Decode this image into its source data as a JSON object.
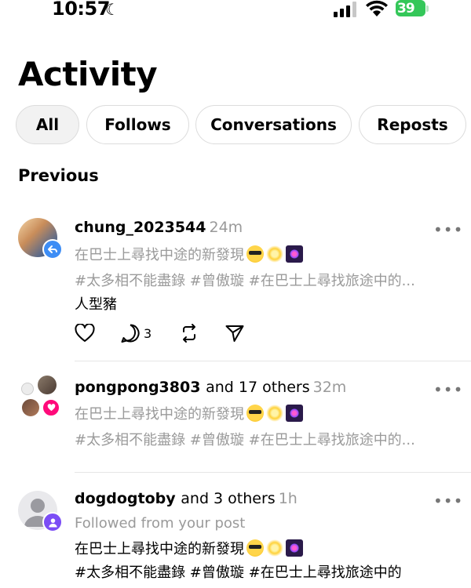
{
  "status": {
    "time": "10:57",
    "battery": "39"
  },
  "title": "Activity",
  "tabs": [
    {
      "label": "All"
    },
    {
      "label": "Follows"
    },
    {
      "label": "Conversations"
    },
    {
      "label": "Reposts"
    }
  ],
  "section": "Previous",
  "items": [
    {
      "username": "chung_2023544",
      "time": "24m",
      "quote": "在巴士上尋找中途的新發現",
      "hashtags": "#太多相不能盡錄 #曾傲璇 #在巴士上尋找旅途中的...",
      "reply": "人型豬",
      "reply_count": "3"
    },
    {
      "username": "pongpong3803",
      "others": "and 17 others",
      "time": "32m",
      "quote": "在巴士上尋找中途的新發現",
      "hashtags": "#太多相不能盡錄 #曾傲璇 #在巴士上尋找旅途中的..."
    },
    {
      "username": "dogdogtoby",
      "others": "and 3 others",
      "time": "1h",
      "subtitle": "Followed from your post",
      "quote": "在巴士上尋找中途的新發現",
      "hashtags": "#太多相不能盡錄 #曾傲璇 #在巴士上尋找旅途中的"
    }
  ],
  "colors": {
    "repost_badge": "#3d8df5",
    "like_badge": "#ff0a7a",
    "follow_badge": "#7b4df5",
    "battery": "#34c759",
    "muted": "#9a9a9a"
  }
}
